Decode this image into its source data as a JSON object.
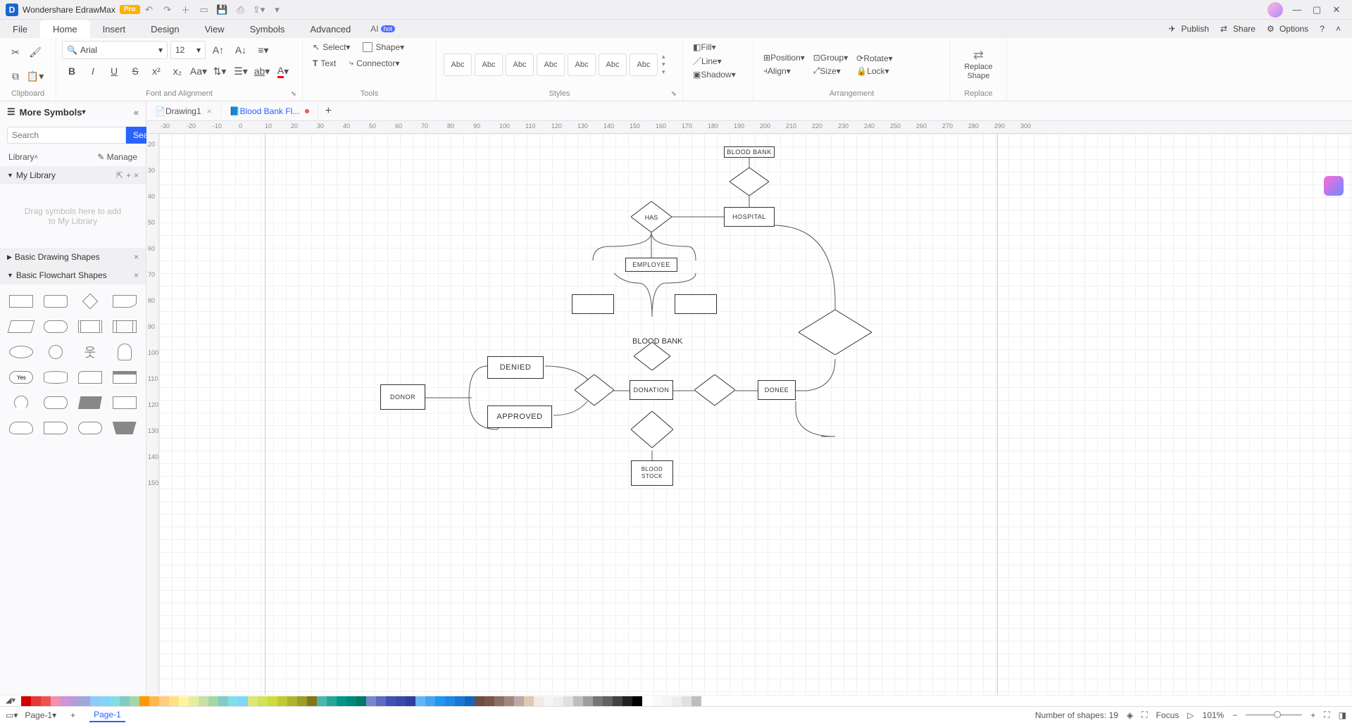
{
  "titlebar": {
    "app": "Wondershare EdrawMax",
    "pro": "Pro"
  },
  "menubar": {
    "tabs": [
      "File",
      "Home",
      "Insert",
      "Design",
      "View",
      "Symbols",
      "Advanced"
    ],
    "active": 1,
    "ai": "AI",
    "hot": "hot",
    "publish": "Publish",
    "share": "Share",
    "options": "Options"
  },
  "ribbon": {
    "font_name": "Arial",
    "font_size": "12",
    "select": "Select",
    "shape": "Shape",
    "text": "Text",
    "connector": "Connector",
    "fill": "Fill",
    "line": "Line",
    "shadow": "Shadow",
    "position": "Position",
    "group": "Group",
    "rotate": "Rotate",
    "align": "Align",
    "size": "Size",
    "lock": "Lock",
    "replace_shape": "Replace Shape",
    "labels": {
      "clipboard": "Clipboard",
      "font": "Font and Alignment",
      "tools": "Tools",
      "styles": "Styles",
      "arrangement": "Arrangement",
      "replace": "Replace"
    },
    "style_preview": "Abc"
  },
  "sidebar": {
    "more_symbols": "More Symbols",
    "search_placeholder": "Search",
    "search_btn": "Search",
    "library": "Library",
    "manage": "Manage",
    "my_library": "My Library",
    "mylib_hint": "Drag symbols here to add to My Library",
    "basic_drawing": "Basic Drawing Shapes",
    "basic_flowchart": "Basic Flowchart Shapes"
  },
  "doc_tabs": {
    "tab1": "Drawing1",
    "tab2": "Blood Bank Fl..."
  },
  "flowchart": {
    "blood_bank_top": "BLOOD BANK",
    "hospital": "HOSPITAL",
    "has": "HAS",
    "employee": "EMPLOYEE",
    "blood_bank_mid": "BLOOD BANK",
    "denied": "DENIED",
    "approved": "APPROVED",
    "donor": "DONOR",
    "donation": "DONATION",
    "donee": "DONEE",
    "blood_stock": "BLOOD STOCK"
  },
  "ruler_h": [
    "-30",
    "-20",
    "-10",
    "0",
    "10",
    "20",
    "30",
    "40",
    "50",
    "60",
    "70",
    "80",
    "90",
    "100",
    "110",
    "120",
    "130",
    "140",
    "150",
    "160",
    "170",
    "180",
    "190",
    "200",
    "210",
    "220",
    "230",
    "240",
    "250",
    "260",
    "270",
    "280",
    "290",
    "300"
  ],
  "ruler_v": [
    "20",
    "30",
    "40",
    "50",
    "60",
    "70",
    "80",
    "90",
    "100",
    "110",
    "120",
    "130",
    "140",
    "150"
  ],
  "colorbar": [
    "#d20000",
    "#e53935",
    "#ef5350",
    "#f48fb1",
    "#ce93d8",
    "#b39ddb",
    "#9fa8da",
    "#90caf9",
    "#81d4fa",
    "#80deea",
    "#80cbc4",
    "#a5d6a7",
    "#ff9800",
    "#ffb74d",
    "#ffcc80",
    "#ffe082",
    "#fff59d",
    "#e6ee9c",
    "#c5e1a5",
    "#a5d6a7",
    "#80cbc4",
    "#80deea",
    "#81d4fa",
    "#dce775",
    "#d4e157",
    "#cddc39",
    "#c0ca33",
    "#afb42b",
    "#9e9d24",
    "#827717",
    "#4db6ac",
    "#26a69a",
    "#009688",
    "#00897b",
    "#00796b",
    "#7986cb",
    "#5c6bc0",
    "#3f51b5",
    "#3949ab",
    "#303f9f",
    "#64b5f6",
    "#42a5f5",
    "#2196f3",
    "#1e88e5",
    "#1976d2",
    "#1565c0",
    "#6d4c41",
    "#795548",
    "#8d6e63",
    "#a1887f",
    "#bcaaa4",
    "#e0c9b0",
    "#efebe9",
    "#f5f5f5",
    "#eeeeee",
    "#e0e0e0",
    "#bdbdbd",
    "#9e9e9e",
    "#757575",
    "#616161",
    "#424242",
    "#212121",
    "#000000",
    "#ffffff",
    "#fafafa",
    "#f5f5f5",
    "#eeeeee",
    "#e0e0e0",
    "#bdbdbd"
  ],
  "statusbar": {
    "page": "Page-1",
    "page_active": "Page-1",
    "shapes": "Number of shapes: 19",
    "focus": "Focus",
    "zoom": "101%"
  }
}
